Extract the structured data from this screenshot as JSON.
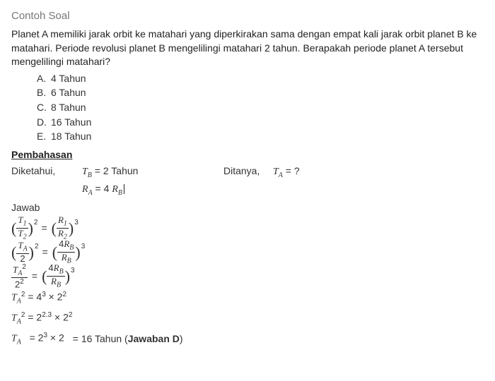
{
  "heading": "Contoh Soal",
  "question": "Planet A memiliki jarak orbit ke matahari yang diperkirakan sama dengan empat kali jarak orbit planet B ke matahari. Periode revolusi planet B mengelilingi matahari 2 tahun. Berapakah periode planet A tersebut mengelilingi matahari?",
  "options": [
    {
      "letter": "A.",
      "text": "4 Tahun"
    },
    {
      "letter": "B.",
      "text": "6 Tahun"
    },
    {
      "letter": "C.",
      "text": "8 Tahun"
    },
    {
      "letter": "D.",
      "text": "16 Tahun"
    },
    {
      "letter": "E.",
      "text": "18 Tahun"
    }
  ],
  "pembahasan_label": "Pembahasan",
  "diketahui_label": "Diketahui,",
  "known": {
    "line1_lhs": "T",
    "line1_sub": "B",
    "line1_eq": " = 2 Tahun",
    "line2_lhs": "R",
    "line2_subA": "A",
    "line2_mid": " = 4 ",
    "line2_rhs": "R",
    "line2_subB": "B"
  },
  "ditanya_label": "Ditanya,",
  "ditanya_expr_T": "T",
  "ditanya_expr_sub": "A",
  "ditanya_expr_rest": " = ?",
  "jawab_label": "Jawab",
  "step1": {
    "left_num_T": "T",
    "left_num_sub": "1",
    "left_den_T": "T",
    "left_den_sub": "2",
    "left_exp": "2",
    "right_num_R": "R",
    "right_num_sub": "1",
    "right_den_R": "R",
    "right_den_sub": "2",
    "right_exp": "3"
  },
  "step2": {
    "left_num_T": "T",
    "left_num_sub": "A",
    "left_den": "2",
    "left_exp": "2",
    "right_num_pre": "4",
    "right_num_R": "R",
    "right_num_sub": "B",
    "right_den_R": "R",
    "right_den_sub": "B",
    "right_exp": "3"
  },
  "step3": {
    "left_num_T": "T",
    "left_num_sub": "A",
    "left_num_exp": "2",
    "left_den_base": "2",
    "left_den_exp": "2",
    "right_num_pre": "4",
    "right_num_R": "R",
    "right_num_sub": "B",
    "right_den_R": "R",
    "right_den_sub": "B",
    "right_exp": "3"
  },
  "step4": {
    "lhs_T": "T",
    "lhs_sub": "A",
    "lhs_exp": "2",
    "rhs": " = 4",
    "rhs_exp": "3",
    "rhs_mid": " × 2",
    "rhs_exp2": "2"
  },
  "step5": {
    "lhs_T": "T",
    "lhs_sub": "A",
    "lhs_exp": "2",
    "rhs": " = 2",
    "rhs_exp": "2.3",
    "rhs_mid": " × 2",
    "rhs_exp2": "2"
  },
  "step6": {
    "lhs_T": "T",
    "lhs_sub": "A",
    "rhs": "= 2",
    "rhs_exp": "3",
    "rhs_mid": " × 2",
    "result": "= 16 Tahun (",
    "bold": "Jawaban D",
    "close": ")"
  },
  "eq_sign": "="
}
